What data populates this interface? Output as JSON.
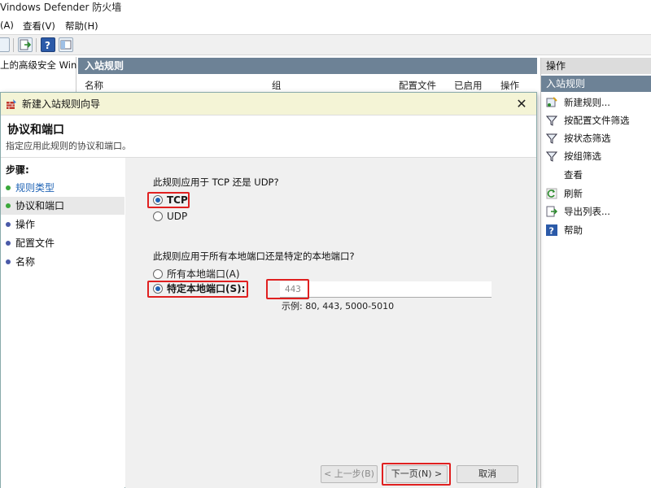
{
  "window": {
    "title": "Vindows Defender 防火墙"
  },
  "menu": {
    "items": [
      "(A)",
      "查看(V)",
      "帮助(H)"
    ]
  },
  "tree": {
    "label": "上的高级安全 Winc"
  },
  "center": {
    "header": "入站规则",
    "columns": [
      "名称",
      "组",
      "配置文件",
      "已启用",
      "操作"
    ]
  },
  "actions": {
    "header": "操作",
    "sub_header": "入站规则",
    "items": [
      {
        "label": "新建规则...",
        "icon": "new-rule-icon"
      },
      {
        "label": "按配置文件筛选",
        "icon": "filter-icon"
      },
      {
        "label": "按状态筛选",
        "icon": "filter-icon"
      },
      {
        "label": "按组筛选",
        "icon": "filter-icon"
      },
      {
        "label": "查看",
        "icon": ""
      },
      {
        "label": "刷新",
        "icon": "refresh-icon"
      },
      {
        "label": "导出列表...",
        "icon": "export-icon"
      },
      {
        "label": "帮助",
        "icon": "help-icon"
      }
    ]
  },
  "wizard": {
    "title": "新建入站规则向导",
    "heading": "协议和端口",
    "subheading": "指定应用此规则的协议和端口。",
    "steps_title": "步骤:",
    "steps": [
      {
        "label": "规则类型",
        "state": "done"
      },
      {
        "label": "协议和端口",
        "state": "current"
      },
      {
        "label": "操作",
        "state": "pending"
      },
      {
        "label": "配置文件",
        "state": "pending"
      },
      {
        "label": "名称",
        "state": "pending"
      }
    ],
    "protocol_question": "此规则应用于 TCP 还是 UDP?",
    "protocols": [
      {
        "label": "TCP",
        "selected": true
      },
      {
        "label": "UDP",
        "selected": false
      }
    ],
    "port_question": "此规则应用于所有本地端口还是特定的本地端口?",
    "port_options": [
      {
        "label": "所有本地端口(A)",
        "selected": false
      },
      {
        "label": "特定本地端口(S):",
        "selected": true
      }
    ],
    "port_value": "443",
    "port_example": "示例: 80, 443, 5000-5010",
    "buttons": {
      "back": "< 上一步(B)",
      "next": "下一页(N) >",
      "cancel": "取消"
    }
  },
  "colors": {
    "accent": "#1f63b5",
    "highlight": "#e02020",
    "panel_header": "#6d8296",
    "dialog_title_bg": "#f4f4d6"
  }
}
